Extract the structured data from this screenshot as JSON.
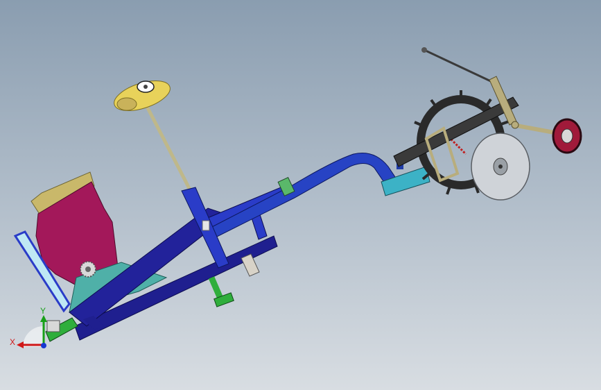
{
  "viewport": {
    "background_top": "#8a9db0",
    "background_bottom": "#d8dde2"
  },
  "model": {
    "parts": [
      "seed-hopper",
      "hopper-lid",
      "main-frame",
      "drawbar",
      "steering-column",
      "hand-wheel",
      "press-wheel",
      "spiked-drive-wheel",
      "disc-coulter",
      "tail-wheel",
      "hitch-link",
      "seed-tube-bracket",
      "foot-pedal"
    ],
    "colors": {
      "hopper": "#a3185a",
      "hopper_lid": "#c9b86a",
      "frame_dark": "#1f1f8f",
      "frame_blue": "#2a3cc8",
      "drawbar": "#2743c4",
      "teal_plate": "#4fb0a8",
      "cyan_block": "#3cb2c6",
      "green_link": "#2fae3c",
      "light_blue_link": "#bfe8f4",
      "gold_wheel": "#e8d25a",
      "khaki_link": "#b8ad7d",
      "dark_wheel": "#2a2a2a",
      "disc": "#cfd3d8",
      "red_wheel": "#a01a3a"
    }
  },
  "triad": {
    "x_label": "X",
    "y_label": "Y",
    "x_color": "#d01818",
    "y_color": "#18a018",
    "z_color": "#1838d0"
  }
}
